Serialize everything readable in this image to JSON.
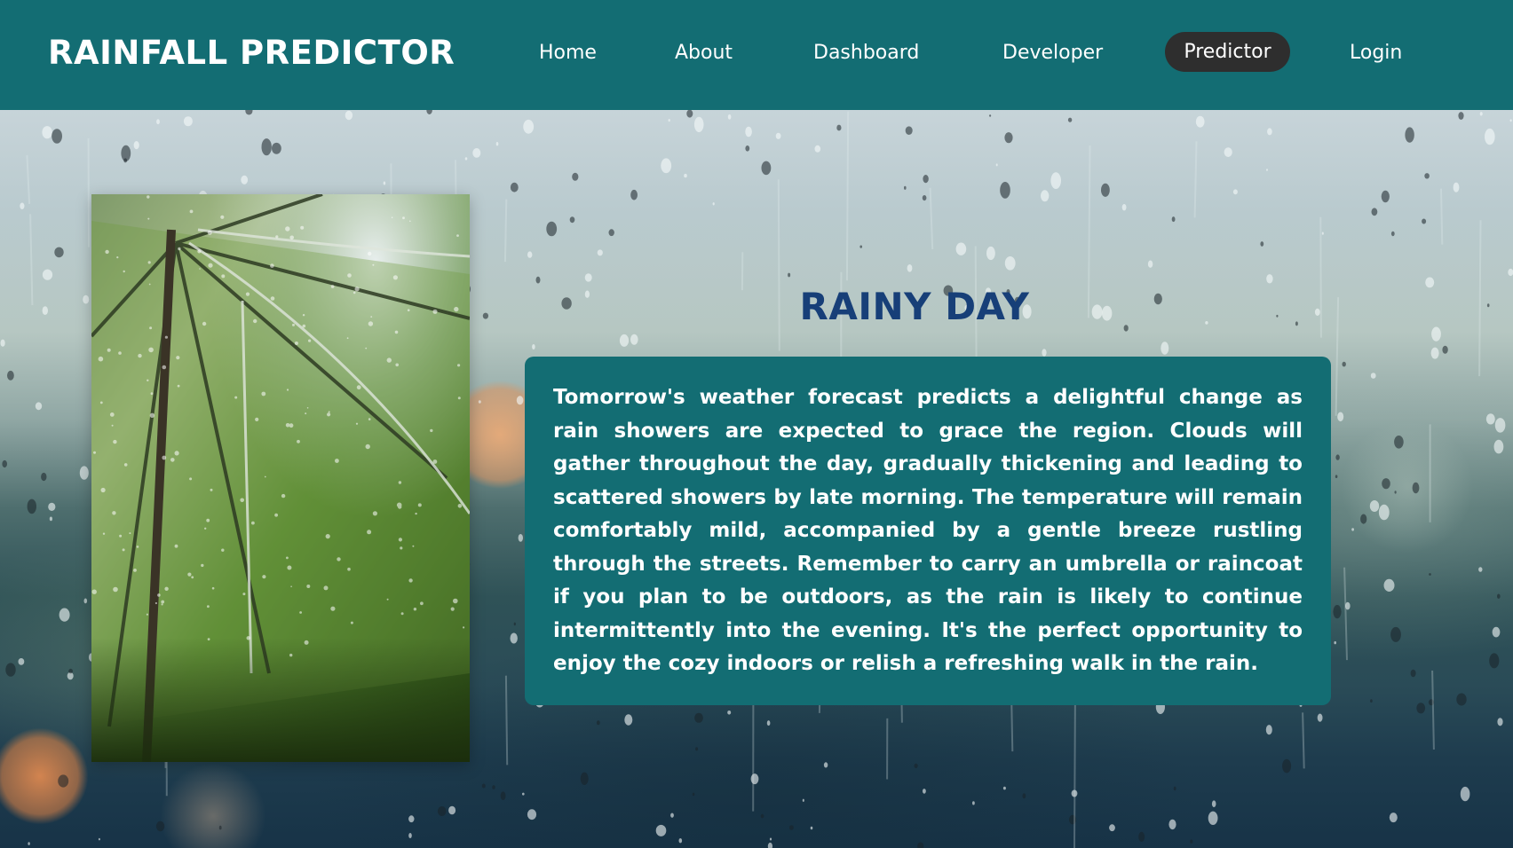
{
  "app": {
    "brand": "RAINFALL PREDICTOR"
  },
  "nav": {
    "items": [
      {
        "label": "Home",
        "active": false
      },
      {
        "label": "About",
        "active": false
      },
      {
        "label": "Dashboard",
        "active": false
      },
      {
        "label": "Developer",
        "active": false
      },
      {
        "label": "Predictor",
        "active": true
      },
      {
        "label": "Login",
        "active": false
      }
    ]
  },
  "main": {
    "image": {
      "icon": "umbrella-in-rain-photo"
    },
    "title": "RAINY DAY",
    "forecast": "Tomorrow's weather forecast predicts a delightful change as rain showers are expected to grace the region. Clouds will gather throughout the day, gradually thickening and leading to scattered showers by late morning. The temperature will remain comfortably mild, accompanied by a gentle breeze rustling through the streets. Remember to carry an umbrella or raincoat if you plan to be outdoors, as the rain is likely to continue intermittently into the evening. It's the perfect opportunity to enjoy the cozy indoors or relish a refreshing walk in the rain."
  },
  "colors": {
    "navbar": "#136d73",
    "active_pill": "#2e2e2e",
    "title": "#173f78",
    "card": "#136d73",
    "text": "#ffffff"
  }
}
